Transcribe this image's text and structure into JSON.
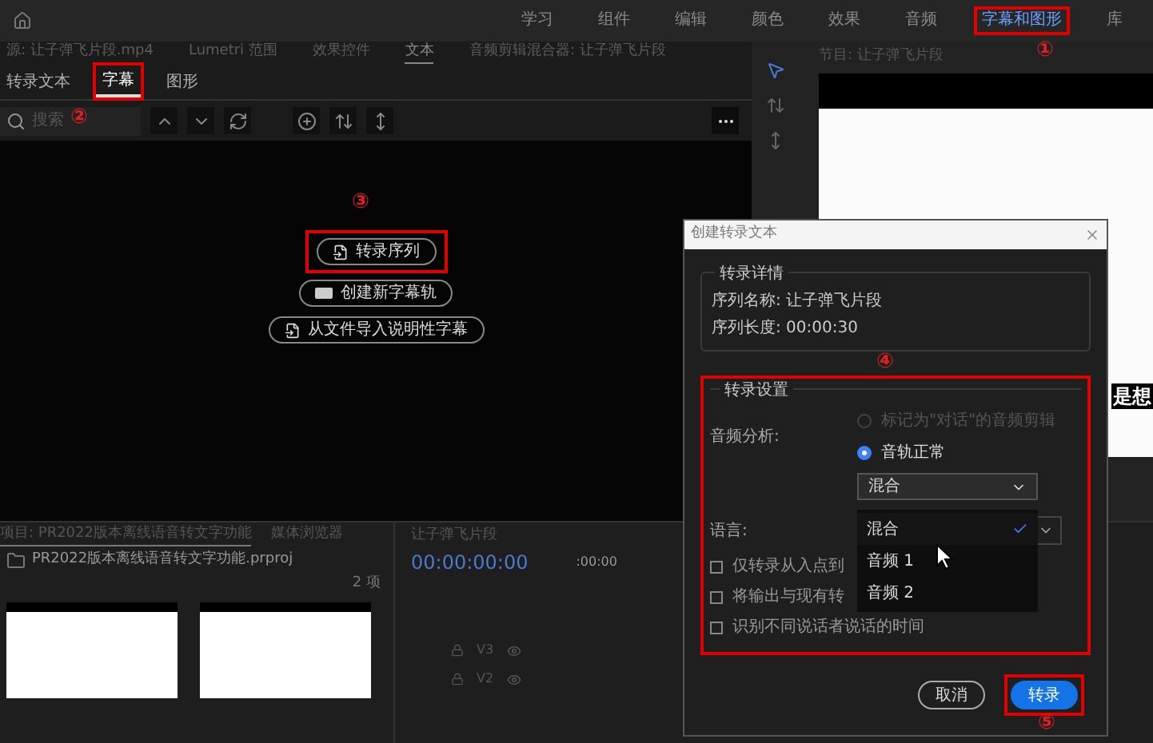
{
  "menu_bar": {
    "workspaces": [
      {
        "label": "学习",
        "selected": false,
        "highlighted": false
      },
      {
        "label": "组件",
        "selected": false,
        "highlighted": false
      },
      {
        "label": "编辑",
        "selected": false,
        "highlighted": false
      },
      {
        "label": "颜色",
        "selected": false,
        "highlighted": false
      },
      {
        "label": "效果",
        "selected": false,
        "highlighted": false
      },
      {
        "label": "音频",
        "selected": false,
        "highlighted": false
      },
      {
        "label": "字幕和图形",
        "selected": true,
        "highlighted": true
      },
      {
        "label": "库",
        "selected": false,
        "highlighted": false
      }
    ],
    "marker": "①"
  },
  "panel_tabs": [
    {
      "label": "源: 让子弹飞片段.mp4",
      "selected": false
    },
    {
      "label": "Lumetri 范围",
      "selected": false
    },
    {
      "label": "效果控件",
      "selected": false
    },
    {
      "label": "文本",
      "selected": true
    },
    {
      "label": "音频剪辑混合器: 让子弹飞片段",
      "selected": false
    }
  ],
  "text_panel": {
    "tabs": [
      {
        "label": "转录文本",
        "selected": false,
        "highlighted": false
      },
      {
        "label": "字幕",
        "selected": true,
        "highlighted": true
      },
      {
        "label": "图形",
        "selected": false,
        "highlighted": false
      }
    ],
    "tabs_marker": "②",
    "search": {
      "placeholder": "搜索"
    },
    "actions_marker": "③",
    "actions": [
      {
        "label": "转录序列",
        "kind": "transcribe",
        "highlighted": true
      },
      {
        "label": "创建新字幕轨",
        "kind": "captions",
        "highlighted": false
      },
      {
        "label": "从文件导入说明性字幕",
        "kind": "import",
        "highlighted": false
      }
    ]
  },
  "program_monitor": {
    "title": "节目: 让子弹飞片段",
    "subtitle": "是想"
  },
  "project_panel": {
    "title": "项目: PR2022版本离线语音转文字功能",
    "tab_2": "媒体浏览器",
    "file": "PR2022版本离线语音转文字功能.prproj",
    "count": "2 项"
  },
  "timeline": {
    "title": "让子弹飞片段",
    "timecode": "00:00:00:00",
    "ruler": ":00:00",
    "tracks": [
      "V3",
      "V2"
    ]
  },
  "dialog": {
    "title": "创建转录文本",
    "details": {
      "legend": "转录详情",
      "lines": [
        "序列名称: 让子弹飞片段",
        "序列长度: 00:00:30"
      ]
    },
    "marker": "④",
    "settings": {
      "legend": "转录设置",
      "highlighted": true,
      "audio_label": "音频分析:",
      "radios": [
        {
          "label": "标记为\"对话\"的音频剪辑",
          "selected": false,
          "disabled": true
        },
        {
          "label": "音轨正常",
          "selected": true,
          "disabled": false
        }
      ],
      "track_select": {
        "value": "混合",
        "expanded": true,
        "options": [
          {
            "label": "混合",
            "selected": true
          },
          {
            "label": "音频 1",
            "selected": false
          },
          {
            "label": "音频 2",
            "selected": false
          }
        ]
      },
      "language_label": "语言:",
      "checkboxes": [
        {
          "label": "仅转录从入点到",
          "checked": false
        },
        {
          "label": "将输出与现有转",
          "checked": false
        },
        {
          "label": "识别不同说话者说话的时间",
          "checked": false
        }
      ]
    },
    "buttons": [
      {
        "label": "取消",
        "kind": "secondary",
        "highlighted": false
      },
      {
        "label": "转录",
        "kind": "primary",
        "highlighted": true
      }
    ],
    "buttons_marker": "⑤"
  }
}
